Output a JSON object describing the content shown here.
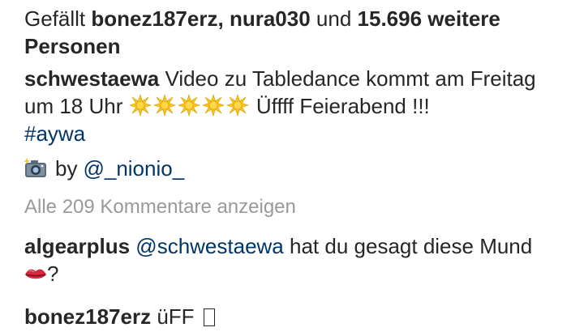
{
  "likes": {
    "prefix": "Gefällt",
    "user1": "bonez187erz",
    "sep": ",",
    "user2": "nura030",
    "und": "und",
    "count": "15.696 weitere Personen"
  },
  "caption": {
    "username": "schwestaewa",
    "text_before_suns": "Video zu Tabledance kommt am Freitag um 18 Uhr",
    "text_after_suns": "Üffff Feierabend !!!",
    "hashtag": "#aywa",
    "sun_icon": "sun-icon",
    "sun_color": "#F5C518"
  },
  "credit": {
    "camera_icon": "camera-icon",
    "by": "by",
    "mention": "@_nionio_"
  },
  "view_all_comments": "Alle 209 Kommentare anzeigen",
  "comments": [
    {
      "username": "algearplus",
      "mention": "@schwestaewa",
      "text": "hat du gesagt diese Mund",
      "emoji": "lips-icon",
      "after_emoji": "?"
    },
    {
      "username": "bonez187erz",
      "text": "üFF",
      "emoji": "missing-glyph-icon"
    }
  ],
  "colors": {
    "text": "#262626",
    "link": "#003569",
    "muted": "#999999"
  }
}
